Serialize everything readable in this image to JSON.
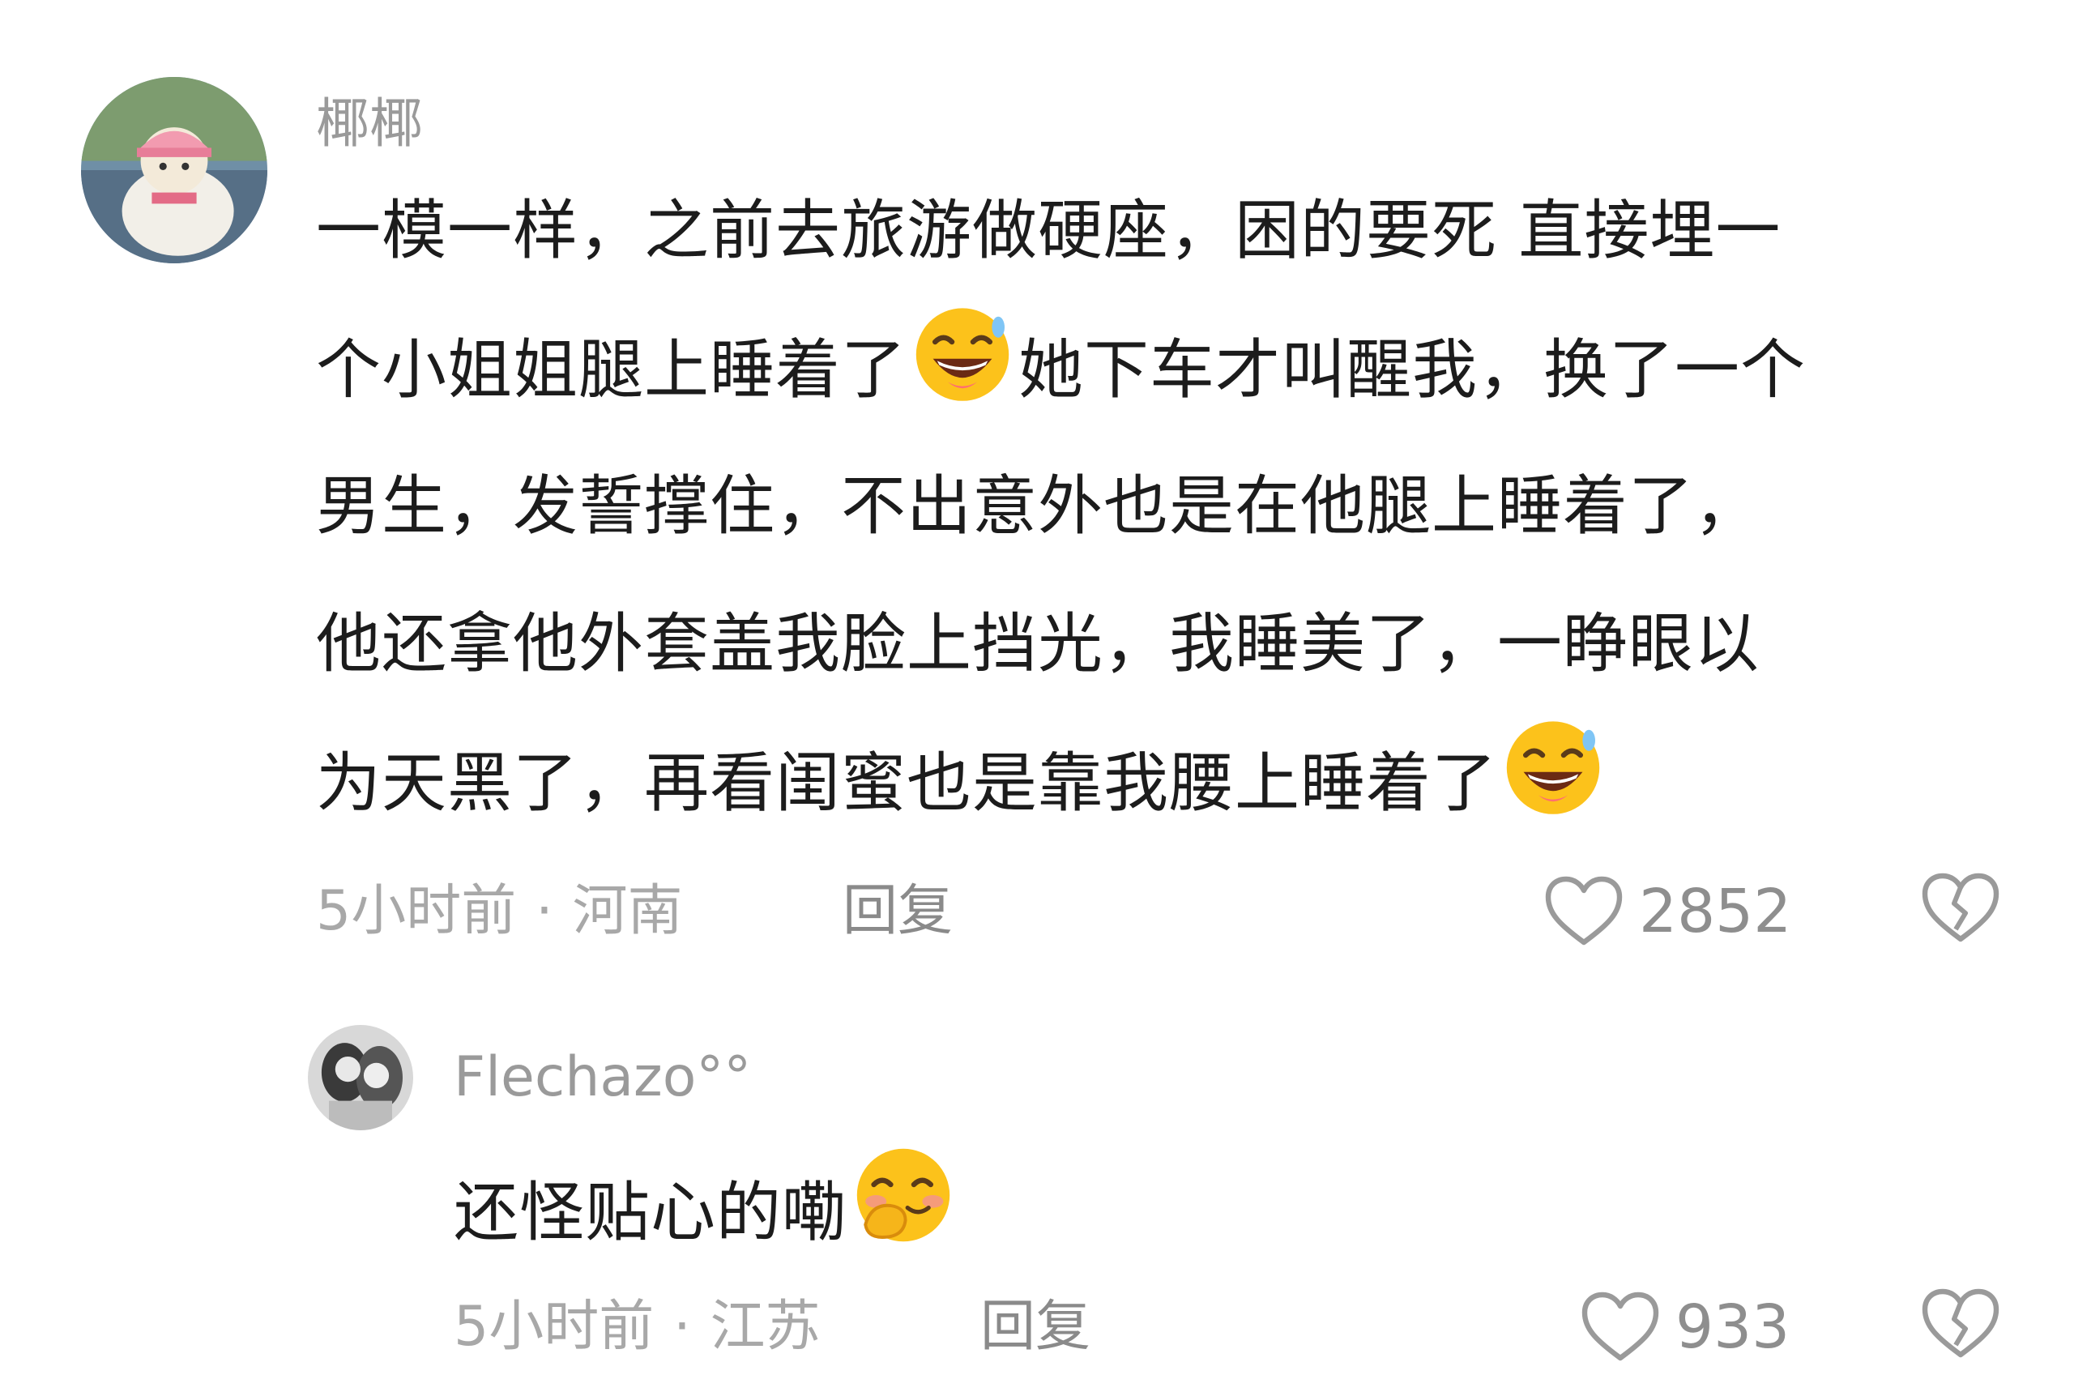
{
  "comments": [
    {
      "username": "椰椰",
      "avatar_icon": "avatar-icon",
      "text_lines": [
        "一模一样，之前去旅游做硬座，困的要死 直接埋一",
        "个小姐姐腿上睡着了",
        "她下车才叫醒我，换了一个",
        "男生，发誓撑住，不出意外也是在他腿上睡着了，",
        "他还拿他外套盖我脸上挡光，我睡美了，一睁眼以",
        "为天黑了，再看闺蜜也是靠我腰上睡着了"
      ],
      "time": "5小时前",
      "location": "河南",
      "reply_label": "回复",
      "like_count": "2852",
      "like_icon": "heart-outline-icon",
      "dislike_icon": "broken-heart-icon",
      "emoji": "grinning-sweat-face"
    },
    {
      "username": "Flechazo°°",
      "avatar_icon": "avatar-icon",
      "text": "还怪贴心的嘞",
      "time": "5小时前",
      "location": "江苏",
      "reply_label": "回复",
      "like_count": "933",
      "like_icon": "heart-outline-icon",
      "dislike_icon": "broken-heart-icon",
      "emoji": "blushing-hand-over-mouth-face"
    }
  ],
  "separator": "·",
  "colors": {
    "username": "#9a9a9a",
    "body": "#1c1c1c",
    "meta": "#a8a8a8",
    "emoji_yellow": "#fcc21b"
  }
}
